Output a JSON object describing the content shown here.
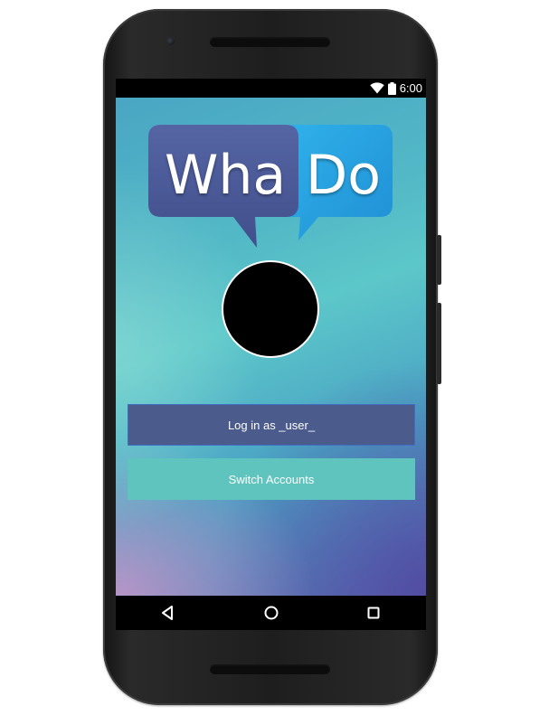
{
  "status_bar": {
    "time": "6:00",
    "icons": [
      "wifi-icon",
      "battery-icon"
    ]
  },
  "logo": {
    "left_word": "Wha",
    "right_word": "Do",
    "left_bubble_color": "#4a5a96",
    "right_bubble_color": "#2aa3e0"
  },
  "avatar": {
    "fill_color": "#000000",
    "border_color": "#ffffff"
  },
  "buttons": {
    "login_label": "Log in as _user_",
    "switch_label": "Switch Accounts",
    "login_color": "#4b5b8c",
    "switch_color": "#5fc4bd"
  },
  "nav_bar": {
    "icons": [
      "back-icon",
      "home-icon",
      "recents-icon"
    ]
  }
}
